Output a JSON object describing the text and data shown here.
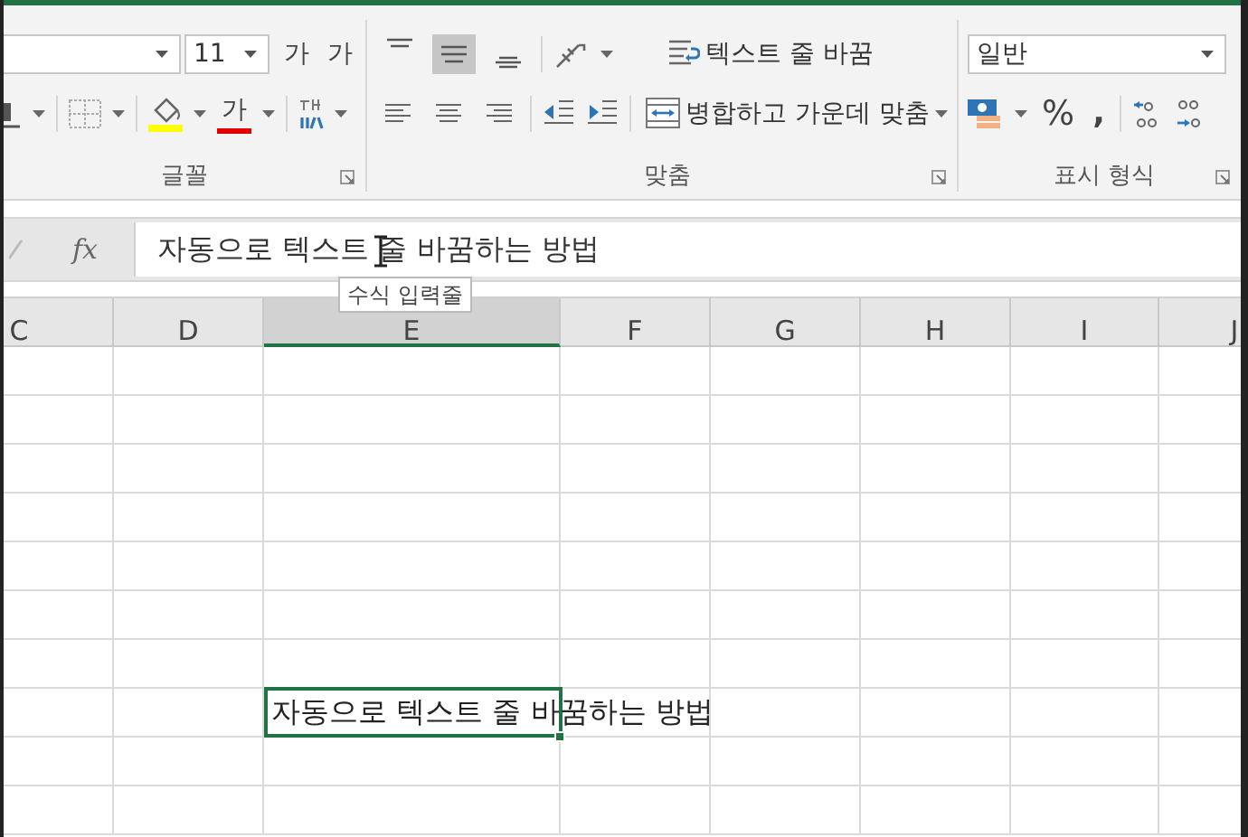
{
  "ribbon": {
    "font_group": {
      "label": "글꼴",
      "font_size": "11",
      "grow_font": "가",
      "shrink_font": "가",
      "font_color": "가"
    },
    "alignment_group": {
      "label": "맞춤",
      "vertical_align": [
        {
          "selected": false
        },
        {
          "selected": true
        },
        {
          "selected": false
        }
      ],
      "wrap_text": {
        "label": "텍스트 줄 바꿈"
      },
      "merge": {
        "label": "병합하고 가운데 맞춤"
      }
    },
    "number_group": {
      "label": "표시 형식",
      "format": "일반",
      "percent": "%",
      "comma": ","
    }
  },
  "formula_bar": {
    "fx": "fx",
    "value": "자동으로 텍스트 줄 바꿈하는 방법"
  },
  "tooltip": {
    "text": "수식 입력줄"
  },
  "columns": [
    {
      "label": "C",
      "selected": false
    },
    {
      "label": "D",
      "selected": false
    },
    {
      "label": "E",
      "selected": true
    },
    {
      "label": "F",
      "selected": false
    },
    {
      "label": "G",
      "selected": false
    },
    {
      "label": "H",
      "selected": false
    },
    {
      "label": "I",
      "selected": false
    },
    {
      "label": "J",
      "selected": false
    }
  ],
  "active_cell": {
    "value": "자동으로 텍스트 줄 바꿈하는 방법"
  }
}
